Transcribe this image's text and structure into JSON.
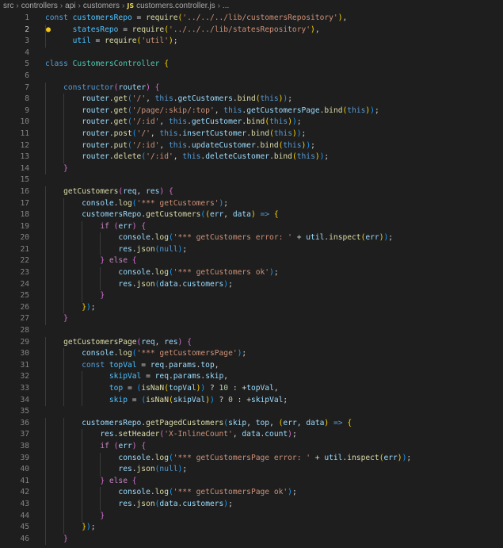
{
  "breadcrumb": {
    "items": [
      "src",
      "controllers",
      "api",
      "customers"
    ],
    "file_icon": "JS",
    "file_name": "customers.controller.js",
    "trailing": "..."
  },
  "code_lines": [
    [
      [
        "kw",
        "const "
      ],
      [
        "cs",
        "customersRepo"
      ],
      [
        "pl",
        " = "
      ],
      [
        "fn",
        "require"
      ],
      [
        "b1",
        "("
      ],
      [
        "st",
        "'../../../lib/customersRepository'"
      ],
      [
        "b1",
        ")"
      ],
      [
        "pl",
        ","
      ]
    ],
    [
      [
        "pl",
        "      "
      ],
      [
        "cs",
        "statesRepo"
      ],
      [
        "pl",
        " = "
      ],
      [
        "fn",
        "require"
      ],
      [
        "b1",
        "("
      ],
      [
        "st",
        "'../../../lib/statesRepository'"
      ],
      [
        "b1",
        ")"
      ],
      [
        "pl",
        ","
      ]
    ],
    [
      [
        "pl",
        "      "
      ],
      [
        "cs",
        "util"
      ],
      [
        "pl",
        " = "
      ],
      [
        "fn",
        "require"
      ],
      [
        "b1",
        "("
      ],
      [
        "st",
        "'util'"
      ],
      [
        "b1",
        ")"
      ],
      [
        "pl",
        ";"
      ]
    ],
    [],
    [
      [
        "kw",
        "class "
      ],
      [
        "ty",
        "CustomersController"
      ],
      [
        "pl",
        " "
      ],
      [
        "b1",
        "{"
      ]
    ],
    [],
    [
      [
        "pl",
        "    "
      ],
      [
        "kw",
        "constructor"
      ],
      [
        "b2",
        "("
      ],
      [
        "vr",
        "router"
      ],
      [
        "b2",
        ")"
      ],
      [
        "pl",
        " "
      ],
      [
        "b2",
        "{"
      ]
    ],
    [
      [
        "pl",
        "        "
      ],
      [
        "vr",
        "router"
      ],
      [
        "pl",
        "."
      ],
      [
        "fn",
        "get"
      ],
      [
        "b3",
        "("
      ],
      [
        "st",
        "'/'"
      ],
      [
        "pl",
        ", "
      ],
      [
        "kw",
        "this"
      ],
      [
        "pl",
        "."
      ],
      [
        "vr",
        "getCustomers"
      ],
      [
        "pl",
        "."
      ],
      [
        "fn",
        "bind"
      ],
      [
        "b1",
        "("
      ],
      [
        "kw",
        "this"
      ],
      [
        "b1",
        ")"
      ],
      [
        "b3",
        ")"
      ],
      [
        "pl",
        ";"
      ]
    ],
    [
      [
        "pl",
        "        "
      ],
      [
        "vr",
        "router"
      ],
      [
        "pl",
        "."
      ],
      [
        "fn",
        "get"
      ],
      [
        "b3",
        "("
      ],
      [
        "st",
        "'/page/:skip/:top'"
      ],
      [
        "pl",
        ", "
      ],
      [
        "kw",
        "this"
      ],
      [
        "pl",
        "."
      ],
      [
        "vr",
        "getCustomersPage"
      ],
      [
        "pl",
        "."
      ],
      [
        "fn",
        "bind"
      ],
      [
        "b1",
        "("
      ],
      [
        "kw",
        "this"
      ],
      [
        "b1",
        ")"
      ],
      [
        "b3",
        ")"
      ],
      [
        "pl",
        ";"
      ]
    ],
    [
      [
        "pl",
        "        "
      ],
      [
        "vr",
        "router"
      ],
      [
        "pl",
        "."
      ],
      [
        "fn",
        "get"
      ],
      [
        "b3",
        "("
      ],
      [
        "st",
        "'/:id'"
      ],
      [
        "pl",
        ", "
      ],
      [
        "kw",
        "this"
      ],
      [
        "pl",
        "."
      ],
      [
        "vr",
        "getCustomer"
      ],
      [
        "pl",
        "."
      ],
      [
        "fn",
        "bind"
      ],
      [
        "b1",
        "("
      ],
      [
        "kw",
        "this"
      ],
      [
        "b1",
        ")"
      ],
      [
        "b3",
        ")"
      ],
      [
        "pl",
        ";"
      ]
    ],
    [
      [
        "pl",
        "        "
      ],
      [
        "vr",
        "router"
      ],
      [
        "pl",
        "."
      ],
      [
        "fn",
        "post"
      ],
      [
        "b3",
        "("
      ],
      [
        "st",
        "'/'"
      ],
      [
        "pl",
        ", "
      ],
      [
        "kw",
        "this"
      ],
      [
        "pl",
        "."
      ],
      [
        "vr",
        "insertCustomer"
      ],
      [
        "pl",
        "."
      ],
      [
        "fn",
        "bind"
      ],
      [
        "b1",
        "("
      ],
      [
        "kw",
        "this"
      ],
      [
        "b1",
        ")"
      ],
      [
        "b3",
        ")"
      ],
      [
        "pl",
        ";"
      ]
    ],
    [
      [
        "pl",
        "        "
      ],
      [
        "vr",
        "router"
      ],
      [
        "pl",
        "."
      ],
      [
        "fn",
        "put"
      ],
      [
        "b3",
        "("
      ],
      [
        "st",
        "'/:id'"
      ],
      [
        "pl",
        ", "
      ],
      [
        "kw",
        "this"
      ],
      [
        "pl",
        "."
      ],
      [
        "vr",
        "updateCustomer"
      ],
      [
        "pl",
        "."
      ],
      [
        "fn",
        "bind"
      ],
      [
        "b1",
        "("
      ],
      [
        "kw",
        "this"
      ],
      [
        "b1",
        ")"
      ],
      [
        "b3",
        ")"
      ],
      [
        "pl",
        ";"
      ]
    ],
    [
      [
        "pl",
        "        "
      ],
      [
        "vr",
        "router"
      ],
      [
        "pl",
        "."
      ],
      [
        "fn",
        "delete"
      ],
      [
        "b3",
        "("
      ],
      [
        "st",
        "'/:id'"
      ],
      [
        "pl",
        ", "
      ],
      [
        "kw",
        "this"
      ],
      [
        "pl",
        "."
      ],
      [
        "vr",
        "deleteCustomer"
      ],
      [
        "pl",
        "."
      ],
      [
        "fn",
        "bind"
      ],
      [
        "b1",
        "("
      ],
      [
        "kw",
        "this"
      ],
      [
        "b1",
        ")"
      ],
      [
        "b3",
        ")"
      ],
      [
        "pl",
        ";"
      ]
    ],
    [
      [
        "pl",
        "    "
      ],
      [
        "b2",
        "}"
      ]
    ],
    [],
    [
      [
        "pl",
        "    "
      ],
      [
        "fn",
        "getCustomers"
      ],
      [
        "b2",
        "("
      ],
      [
        "vr",
        "req"
      ],
      [
        "pl",
        ", "
      ],
      [
        "vr",
        "res"
      ],
      [
        "b2",
        ")"
      ],
      [
        "pl",
        " "
      ],
      [
        "b2",
        "{"
      ]
    ],
    [
      [
        "pl",
        "        "
      ],
      [
        "vr",
        "console"
      ],
      [
        "pl",
        "."
      ],
      [
        "fn",
        "log"
      ],
      [
        "b3",
        "("
      ],
      [
        "st",
        "'*** getCustomers'"
      ],
      [
        "b3",
        ")"
      ],
      [
        "pl",
        ";"
      ]
    ],
    [
      [
        "pl",
        "        "
      ],
      [
        "vr",
        "customersRepo"
      ],
      [
        "pl",
        "."
      ],
      [
        "fn",
        "getCustomers"
      ],
      [
        "b3",
        "("
      ],
      [
        "b1",
        "("
      ],
      [
        "vr",
        "err"
      ],
      [
        "pl",
        ", "
      ],
      [
        "vr",
        "data"
      ],
      [
        "b1",
        ")"
      ],
      [
        "pl",
        " "
      ],
      [
        "kw",
        "=>"
      ],
      [
        "pl",
        " "
      ],
      [
        "b1",
        "{"
      ]
    ],
    [
      [
        "pl",
        "            "
      ],
      [
        "kc",
        "if"
      ],
      [
        "pl",
        " "
      ],
      [
        "b2",
        "("
      ],
      [
        "vr",
        "err"
      ],
      [
        "b2",
        ")"
      ],
      [
        "pl",
        " "
      ],
      [
        "b2",
        "{"
      ]
    ],
    [
      [
        "pl",
        "                "
      ],
      [
        "vr",
        "console"
      ],
      [
        "pl",
        "."
      ],
      [
        "fn",
        "log"
      ],
      [
        "b3",
        "("
      ],
      [
        "st",
        "'*** getCustomers error: '"
      ],
      [
        "pl",
        " + "
      ],
      [
        "vr",
        "util"
      ],
      [
        "pl",
        "."
      ],
      [
        "fn",
        "inspect"
      ],
      [
        "b1",
        "("
      ],
      [
        "vr",
        "err"
      ],
      [
        "b1",
        ")"
      ],
      [
        "b3",
        ")"
      ],
      [
        "pl",
        ";"
      ]
    ],
    [
      [
        "pl",
        "                "
      ],
      [
        "vr",
        "res"
      ],
      [
        "pl",
        "."
      ],
      [
        "fn",
        "json"
      ],
      [
        "b3",
        "("
      ],
      [
        "kw",
        "null"
      ],
      [
        "b3",
        ")"
      ],
      [
        "pl",
        ";"
      ]
    ],
    [
      [
        "pl",
        "            "
      ],
      [
        "b2",
        "}"
      ],
      [
        "pl",
        " "
      ],
      [
        "kc",
        "else"
      ],
      [
        "pl",
        " "
      ],
      [
        "b2",
        "{"
      ]
    ],
    [
      [
        "pl",
        "                "
      ],
      [
        "vr",
        "console"
      ],
      [
        "pl",
        "."
      ],
      [
        "fn",
        "log"
      ],
      [
        "b3",
        "("
      ],
      [
        "st",
        "'*** getCustomers ok'"
      ],
      [
        "b3",
        ")"
      ],
      [
        "pl",
        ";"
      ]
    ],
    [
      [
        "pl",
        "                "
      ],
      [
        "vr",
        "res"
      ],
      [
        "pl",
        "."
      ],
      [
        "fn",
        "json"
      ],
      [
        "b3",
        "("
      ],
      [
        "vr",
        "data"
      ],
      [
        "pl",
        "."
      ],
      [
        "vr",
        "customers"
      ],
      [
        "b3",
        ")"
      ],
      [
        "pl",
        ";"
      ]
    ],
    [
      [
        "pl",
        "            "
      ],
      [
        "b2",
        "}"
      ]
    ],
    [
      [
        "pl",
        "        "
      ],
      [
        "b1",
        "}"
      ],
      [
        "b3",
        ")"
      ],
      [
        "pl",
        ";"
      ]
    ],
    [
      [
        "pl",
        "    "
      ],
      [
        "b2",
        "}"
      ]
    ],
    [],
    [
      [
        "pl",
        "    "
      ],
      [
        "fn",
        "getCustomersPage"
      ],
      [
        "b2",
        "("
      ],
      [
        "vr",
        "req"
      ],
      [
        "pl",
        ", "
      ],
      [
        "vr",
        "res"
      ],
      [
        "b2",
        ")"
      ],
      [
        "pl",
        " "
      ],
      [
        "b2",
        "{"
      ]
    ],
    [
      [
        "pl",
        "        "
      ],
      [
        "vr",
        "console"
      ],
      [
        "pl",
        "."
      ],
      [
        "fn",
        "log"
      ],
      [
        "b3",
        "("
      ],
      [
        "st",
        "'*** getCustomersPage'"
      ],
      [
        "b3",
        ")"
      ],
      [
        "pl",
        ";"
      ]
    ],
    [
      [
        "pl",
        "        "
      ],
      [
        "kw",
        "const "
      ],
      [
        "cs",
        "topVal"
      ],
      [
        "pl",
        " = "
      ],
      [
        "vr",
        "req"
      ],
      [
        "pl",
        "."
      ],
      [
        "vr",
        "params"
      ],
      [
        "pl",
        "."
      ],
      [
        "vr",
        "top"
      ],
      [
        "pl",
        ","
      ]
    ],
    [
      [
        "pl",
        "              "
      ],
      [
        "cs",
        "skipVal"
      ],
      [
        "pl",
        " = "
      ],
      [
        "vr",
        "req"
      ],
      [
        "pl",
        "."
      ],
      [
        "vr",
        "params"
      ],
      [
        "pl",
        "."
      ],
      [
        "vr",
        "skip"
      ],
      [
        "pl",
        ","
      ]
    ],
    [
      [
        "pl",
        "              "
      ],
      [
        "cs",
        "top"
      ],
      [
        "pl",
        " = "
      ],
      [
        "b3",
        "("
      ],
      [
        "fn",
        "isNaN"
      ],
      [
        "b1",
        "("
      ],
      [
        "vr",
        "topVal"
      ],
      [
        "b1",
        ")"
      ],
      [
        "b3",
        ")"
      ],
      [
        "pl",
        " ? "
      ],
      [
        "nu",
        "10"
      ],
      [
        "pl",
        " : +"
      ],
      [
        "vr",
        "topVal"
      ],
      [
        "pl",
        ","
      ]
    ],
    [
      [
        "pl",
        "              "
      ],
      [
        "cs",
        "skip"
      ],
      [
        "pl",
        " = "
      ],
      [
        "b3",
        "("
      ],
      [
        "fn",
        "isNaN"
      ],
      [
        "b1",
        "("
      ],
      [
        "vr",
        "skipVal"
      ],
      [
        "b1",
        ")"
      ],
      [
        "b3",
        ")"
      ],
      [
        "pl",
        " ? "
      ],
      [
        "nu",
        "0"
      ],
      [
        "pl",
        " : +"
      ],
      [
        "vr",
        "skipVal"
      ],
      [
        "pl",
        ";"
      ]
    ],
    [],
    [
      [
        "pl",
        "        "
      ],
      [
        "vr",
        "customersRepo"
      ],
      [
        "pl",
        "."
      ],
      [
        "fn",
        "getPagedCustomers"
      ],
      [
        "b3",
        "("
      ],
      [
        "vr",
        "skip"
      ],
      [
        "pl",
        ", "
      ],
      [
        "vr",
        "top"
      ],
      [
        "pl",
        ", "
      ],
      [
        "b1",
        "("
      ],
      [
        "vr",
        "err"
      ],
      [
        "pl",
        ", "
      ],
      [
        "vr",
        "data"
      ],
      [
        "b1",
        ")"
      ],
      [
        "pl",
        " "
      ],
      [
        "kw",
        "=>"
      ],
      [
        "pl",
        " "
      ],
      [
        "b1",
        "{"
      ]
    ],
    [
      [
        "pl",
        "            "
      ],
      [
        "vr",
        "res"
      ],
      [
        "pl",
        "."
      ],
      [
        "fn",
        "setHeader"
      ],
      [
        "b2",
        "("
      ],
      [
        "st",
        "'X-InlineCount'"
      ],
      [
        "pl",
        ", "
      ],
      [
        "vr",
        "data"
      ],
      [
        "pl",
        "."
      ],
      [
        "vr",
        "count"
      ],
      [
        "b2",
        ")"
      ],
      [
        "pl",
        ";"
      ]
    ],
    [
      [
        "pl",
        "            "
      ],
      [
        "kc",
        "if"
      ],
      [
        "pl",
        " "
      ],
      [
        "b2",
        "("
      ],
      [
        "vr",
        "err"
      ],
      [
        "b2",
        ")"
      ],
      [
        "pl",
        " "
      ],
      [
        "b2",
        "{"
      ]
    ],
    [
      [
        "pl",
        "                "
      ],
      [
        "vr",
        "console"
      ],
      [
        "pl",
        "."
      ],
      [
        "fn",
        "log"
      ],
      [
        "b3",
        "("
      ],
      [
        "st",
        "'*** getCustomersPage error: '"
      ],
      [
        "pl",
        " + "
      ],
      [
        "vr",
        "util"
      ],
      [
        "pl",
        "."
      ],
      [
        "fn",
        "inspect"
      ],
      [
        "b1",
        "("
      ],
      [
        "vr",
        "err"
      ],
      [
        "b1",
        ")"
      ],
      [
        "b3",
        ")"
      ],
      [
        "pl",
        ";"
      ]
    ],
    [
      [
        "pl",
        "                "
      ],
      [
        "vr",
        "res"
      ],
      [
        "pl",
        "."
      ],
      [
        "fn",
        "json"
      ],
      [
        "b3",
        "("
      ],
      [
        "kw",
        "null"
      ],
      [
        "b3",
        ")"
      ],
      [
        "pl",
        ";"
      ]
    ],
    [
      [
        "pl",
        "            "
      ],
      [
        "b2",
        "}"
      ],
      [
        "pl",
        " "
      ],
      [
        "kc",
        "else"
      ],
      [
        "pl",
        " "
      ],
      [
        "b2",
        "{"
      ]
    ],
    [
      [
        "pl",
        "                "
      ],
      [
        "vr",
        "console"
      ],
      [
        "pl",
        "."
      ],
      [
        "fn",
        "log"
      ],
      [
        "b3",
        "("
      ],
      [
        "st",
        "'*** getCustomersPage ok'"
      ],
      [
        "b3",
        ")"
      ],
      [
        "pl",
        ";"
      ]
    ],
    [
      [
        "pl",
        "                "
      ],
      [
        "vr",
        "res"
      ],
      [
        "pl",
        "."
      ],
      [
        "fn",
        "json"
      ],
      [
        "b3",
        "("
      ],
      [
        "vr",
        "data"
      ],
      [
        "pl",
        "."
      ],
      [
        "vr",
        "customers"
      ],
      [
        "b3",
        ")"
      ],
      [
        "pl",
        ";"
      ]
    ],
    [
      [
        "pl",
        "            "
      ],
      [
        "b2",
        "}"
      ]
    ],
    [
      [
        "pl",
        "        "
      ],
      [
        "b1",
        "}"
      ],
      [
        "b3",
        ")"
      ],
      [
        "pl",
        ";"
      ]
    ],
    [
      [
        "pl",
        "    "
      ],
      [
        "b2",
        "}"
      ]
    ]
  ],
  "active_line": 2,
  "lightbulb_line": 2,
  "lightbulb_icon": "lightbulb-icon",
  "colors": {
    "background": "#1e1e1e",
    "line_number": "#858585",
    "keyword": "#569cd6",
    "control": "#c586c0",
    "variable": "#9cdcfe",
    "constant": "#4fc1ff",
    "function": "#dcdcaa",
    "string": "#ce9178",
    "type": "#4ec9b0",
    "number": "#b5cea8",
    "bracket_gold": "#ffd700",
    "bracket_orchid": "#da70d6",
    "bracket_blue": "#179fff"
  }
}
